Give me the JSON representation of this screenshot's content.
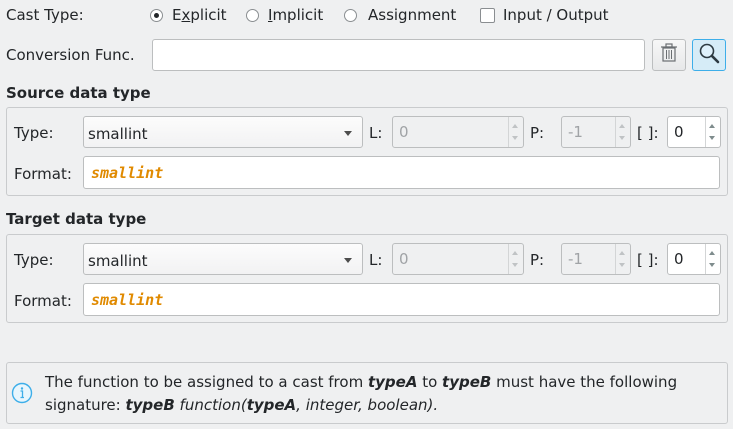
{
  "cast_type": {
    "label": "Cast Type:",
    "options": [
      {
        "prefix": "E",
        "accel": "x",
        "suffix": "plicit",
        "checked": true
      },
      {
        "prefix": "",
        "accel": "I",
        "suffix": "mplicit",
        "checked": false
      },
      {
        "prefix": "",
        "accel": "",
        "suffix": "Assignment",
        "checked": false
      }
    ],
    "io_checkbox": {
      "label": "Input / Output",
      "checked": false
    }
  },
  "conversion": {
    "label": "Conversion Func.",
    "value": "",
    "clear_icon": "trash-icon",
    "search_icon": "search-icon"
  },
  "source": {
    "title": "Source data type",
    "type_label": "Type:",
    "type_value": "smallint",
    "length_label": "L:",
    "length_value": "0",
    "precision_label": "P:",
    "precision_value": "-1",
    "dim_label": "[ ]:",
    "dim_value": "0",
    "format_label": "Format:",
    "format_value": "smallint"
  },
  "target": {
    "title": "Target data type",
    "type_label": "Type:",
    "type_value": "smallint",
    "length_label": "L:",
    "length_value": "0",
    "precision_label": "P:",
    "precision_value": "-1",
    "dim_label": "[ ]:",
    "dim_value": "0",
    "format_label": "Format:",
    "format_value": "smallint"
  },
  "info": {
    "icon": "info-icon",
    "t1": "The function to be assigned to a cast from ",
    "typeA": "typeA",
    "t2": " to ",
    "typeB": "typeB",
    "t3": " must have the following",
    "t4": "signature: ",
    "sig_typeB": "typeB",
    "t5": " function(",
    "sig_typeA": "typeA",
    "t6": ", integer, boolean)."
  },
  "colors": {
    "accent": "#3daee9",
    "format_text": "#e08a00"
  }
}
